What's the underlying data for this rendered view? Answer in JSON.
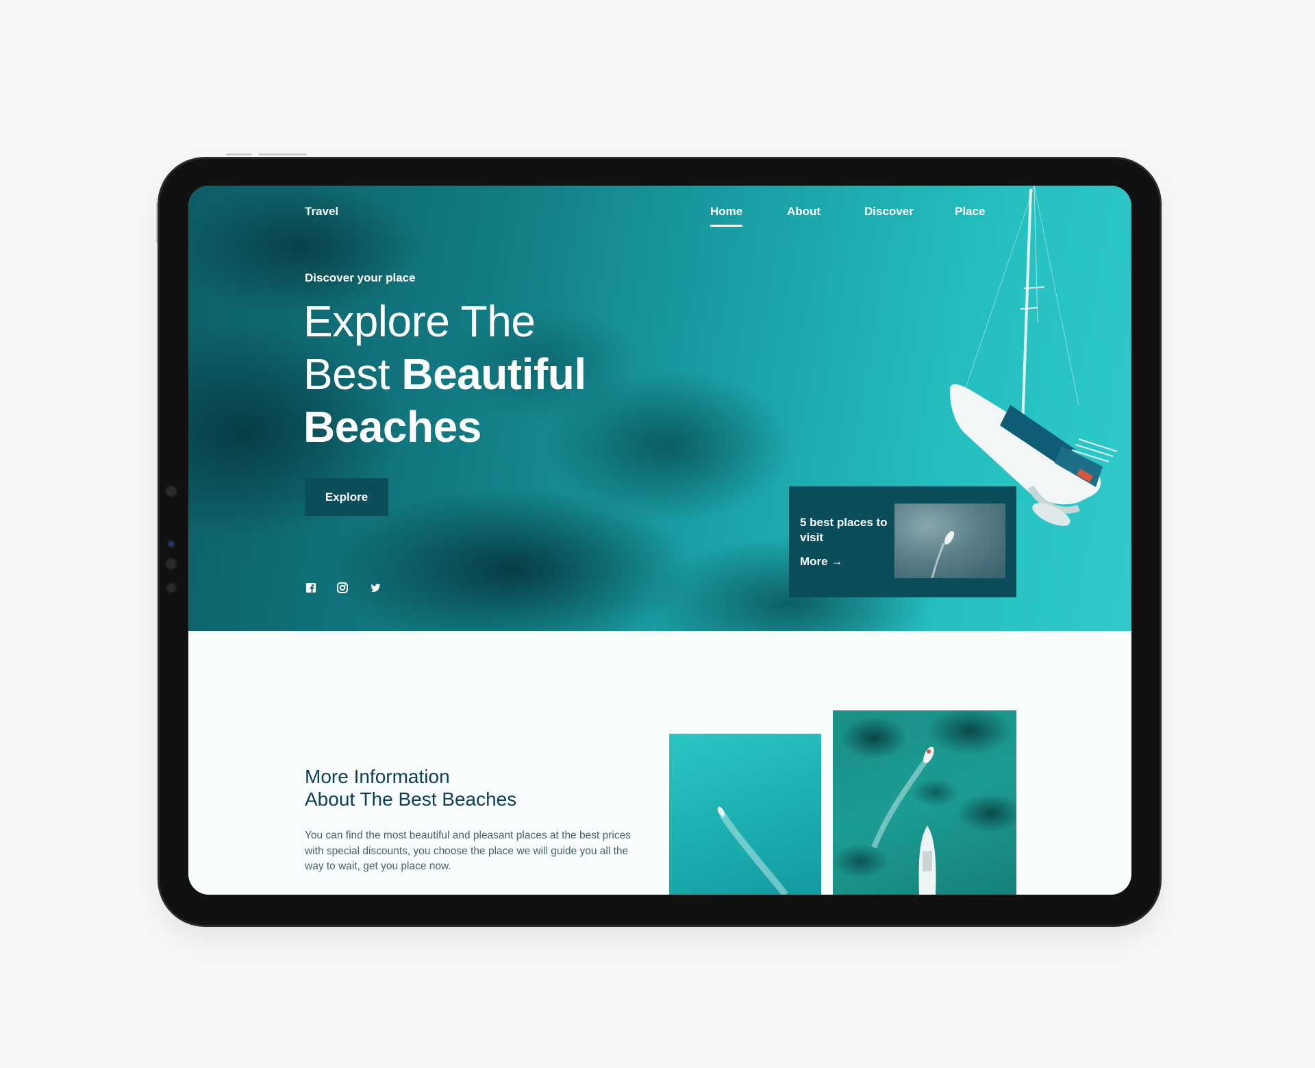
{
  "nav": {
    "logo": "Travel",
    "items": [
      {
        "label": "Home",
        "active": true
      },
      {
        "label": "About",
        "active": false
      },
      {
        "label": "Discover",
        "active": false
      },
      {
        "label": "Place",
        "active": false
      }
    ]
  },
  "hero": {
    "eyebrow": "Discover your place",
    "headline_line1": "Explore The",
    "headline_line2_light": "Best ",
    "headline_line2_bold": "Beautiful",
    "headline_line3": "Beaches",
    "cta": "Explore",
    "social_icons": [
      "facebook-icon",
      "instagram-icon",
      "twitter-icon"
    ]
  },
  "card": {
    "title": "5 best places to visit",
    "more": "More →"
  },
  "info": {
    "title_line1": "More Information",
    "title_line2": "About The Best Beaches",
    "body": "You can find the most beautiful and pleasant places at the best prices with special discounts, you choose the place we will guide you all the way to wait, get you place now."
  },
  "colors": {
    "accent": "#0c4d5c",
    "heading": "#0c3f4f",
    "body_text": "#45626b",
    "sea_light": "#2fcac9",
    "sea_dark": "#0d5d66"
  }
}
